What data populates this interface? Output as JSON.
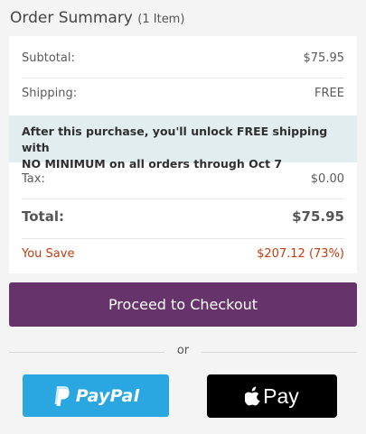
{
  "header": {
    "title": "Order Summary",
    "item_count": "(1 Item)"
  },
  "summary": {
    "subtotal_label": "Subtotal:",
    "subtotal_value": "$75.95",
    "shipping_label": "Shipping:",
    "shipping_value": "FREE",
    "notice_line1": "After this purchase, you'll unlock FREE shipping with",
    "notice_line2": "NO MINIMUM on all orders through Oct 7",
    "tax_label": "Tax:",
    "tax_value": "$0.00",
    "total_label": "Total:",
    "total_value": "$75.95",
    "save_label": "You Save",
    "save_value": "$207.12 (73%)"
  },
  "actions": {
    "checkout_label": "Proceed to Checkout",
    "or_label": "or",
    "paypal_label": "PayPal",
    "applepay_label": "Pay"
  },
  "colors": {
    "checkout_bg": "#66336b",
    "notice_bg": "#e2edef",
    "save_text": "#c43b0e",
    "paypal_bg": "#2aa7e1",
    "applepay_bg": "#000000"
  },
  "icons": {
    "paypal": "paypal-logo-icon",
    "apple": "apple-logo-icon"
  }
}
